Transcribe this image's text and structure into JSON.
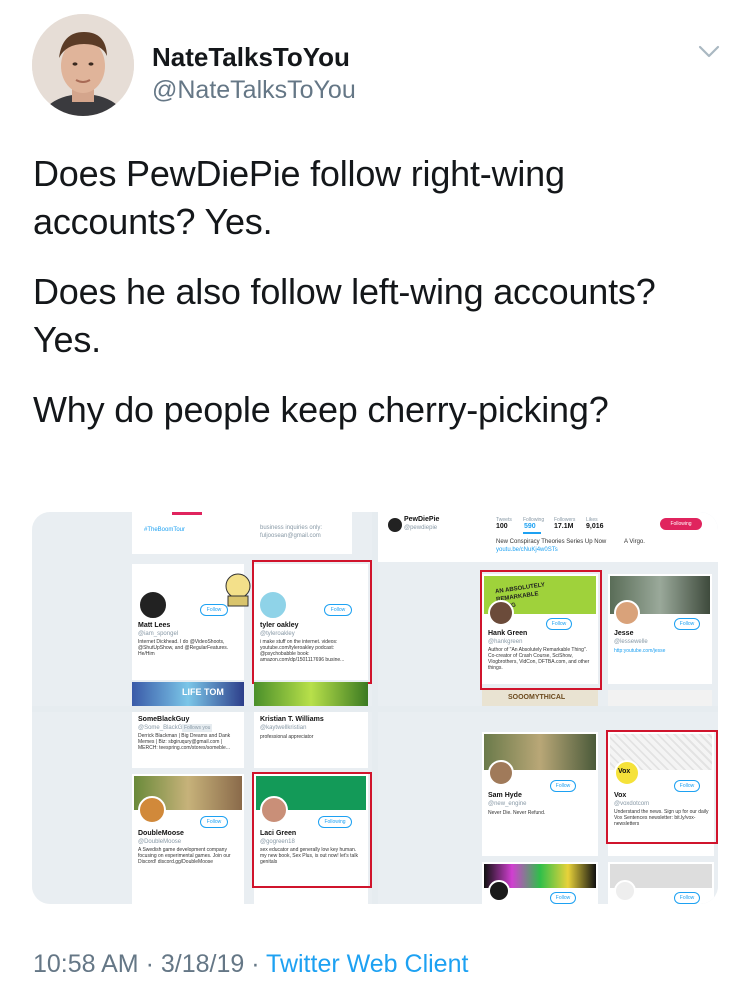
{
  "header": {
    "display_name": "NateTalksToYou",
    "handle": "@NateTalksToYou"
  },
  "tweet": {
    "lines": [
      "Does PewDiePie follow right-wing accounts? Yes.",
      "Does he also follow left-wing accounts? Yes.",
      "Why do people keep cherry-picking?"
    ]
  },
  "screenshots": {
    "top_left": {
      "tabs": [
        "#TheBoomTour"
      ],
      "banner_text": "business inquiries only: fuljoosean@gmail.com",
      "follow_label": "Follow",
      "card1": {
        "name": "Matt Lees",
        "handle": "@iam_spongel",
        "bio": "Internet Dickhead. I do @VideoShoots, @ShutUpShow, and @RegularFeatures. He/Him"
      },
      "card2": {
        "name": "tyler oakley",
        "handle": "@tyleroakley",
        "bio": "i make stuff on the internet. videos: youtube.com/tyleroakley podcast: @psychobabble book: amazon.com/dp/1501117696 busine..."
      },
      "image_label": "LIFE TOM"
    },
    "top_right": {
      "profile_name": "PewDiePie",
      "profile_handle": "@pewdiepie",
      "stats_labels": [
        "Tweets",
        "Following",
        "Followers",
        "Likes"
      ],
      "stats_values": [
        "100",
        "590",
        "17.1M",
        "9,016"
      ],
      "following_label": "Following",
      "bio_text": "New Conspiracy Theories Series Up Now",
      "bio_link": "youtu.be/cNuKj4w0STs",
      "right_text": "A Virgo.",
      "banner_label": "AN ABSOLUTELY REMARKABLE THING",
      "follow_label": "Follow",
      "card1": {
        "name": "Hank Green",
        "handle": "@hankgreen",
        "bio": "Author of \"An Absolutely Remarkable Thing\". Co-creator of Crash Course, SciShow, Vlogbrothers, VidCon, DFTBA.com, and other things."
      },
      "card2": {
        "name": "Jesse",
        "handle": "@lessewelle",
        "bio": "http:youtube.com/jesse"
      },
      "bottom_label": "SOOOMYTHICAL"
    },
    "bottom_left": {
      "follow_label": "Follow",
      "following_label": "Following",
      "card_top1": {
        "name": "SomeBlackGuy",
        "handle": "@Some_BlackGuy",
        "follows_badge": "Follows you",
        "bio": "Derrick Blackman | Big Dreams and Dank Memes | Biz: sbgiruqury@gmail.com | MERCH: teespring.com/stores/someble..."
      },
      "card_top2": {
        "name": "Kristian T. Williams",
        "handle": "@kaytwellkristian",
        "bio": "professional appreciator"
      },
      "card1": {
        "name": "DoubleMoose",
        "handle": "@DoubleMoose",
        "bio": "A Swedish game development company focusing on experimental games. Join our Discord! discord.gg/DoubleMoose"
      },
      "card2": {
        "name": "Laci Green",
        "handle": "@gogreen18",
        "bio": "sex educator and generally low key human. my new book, Sex Plus, is out now! let's talk genitals"
      }
    },
    "bottom_right": {
      "follow_label": "Follow",
      "card1": {
        "name": "Sam Hyde",
        "handle": "@new_engine",
        "bio": "Never Die. Never Refund."
      },
      "card2": {
        "name": "Vox",
        "handle": "@voxdotcom",
        "bio": "Understand the news. Sign up for our daily Vox Sentences newsletter: bit.ly/vox-newsletters",
        "logo_text": "Vox"
      }
    }
  },
  "footer": {
    "time": "10:58 AM",
    "sep": " · ",
    "date": "3/18/19",
    "source": "Twitter Web Client"
  },
  "colors": {
    "accent": "#1da1f2",
    "highlight_box": "#d0142c",
    "following_btn": "#e0245e",
    "text_secondary": "#657786"
  }
}
